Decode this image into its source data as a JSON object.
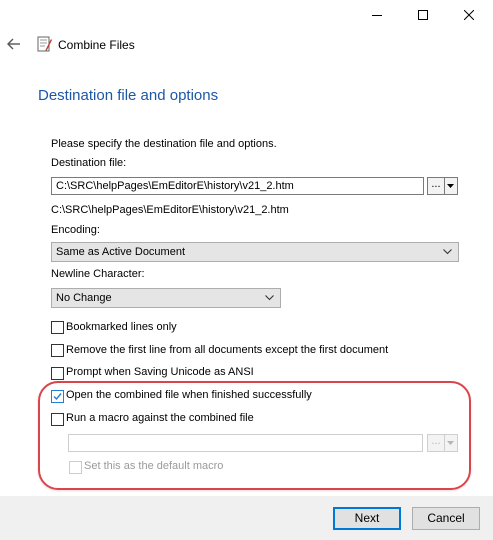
{
  "window": {
    "title": "Combine Files",
    "controls": [
      "minimize-icon",
      "maximize-icon",
      "close-icon"
    ]
  },
  "page": {
    "heading": "Destination file and options",
    "intro": "Please specify the destination file and options."
  },
  "destination": {
    "label": "Destination file:",
    "value": "C:\\SRC\\helpPages\\EmEditorE\\history\\v21_2.htm",
    "browse_label": "...",
    "resolved_path": "C:\\SRC\\helpPages\\EmEditorE\\history\\v21_2.htm"
  },
  "encoding": {
    "label": "Encoding:",
    "selected": "Same as Active Document"
  },
  "newline": {
    "label": "Newline Character:",
    "selected": "No Change"
  },
  "options": [
    {
      "label": "Bookmarked lines only",
      "checked": false,
      "enabled": true
    },
    {
      "label": "Remove the first line from all documents except the first document",
      "checked": false,
      "enabled": true
    },
    {
      "label": "Prompt when Saving Unicode as ANSI",
      "checked": false,
      "enabled": true
    },
    {
      "label": "Open the combined file when finished successfully",
      "checked": true,
      "enabled": true
    },
    {
      "label": "Run a macro against the combined file",
      "checked": false,
      "enabled": true
    }
  ],
  "macro": {
    "path_value": "",
    "browse_label": "...",
    "default_label": "Set this as the default macro",
    "default_checked": false,
    "enabled": false
  },
  "buttons": {
    "next": "Next",
    "cancel": "Cancel"
  },
  "colors": {
    "heading": "#1d57a6",
    "highlight": "#d9454a",
    "accent": "#0078d7"
  }
}
